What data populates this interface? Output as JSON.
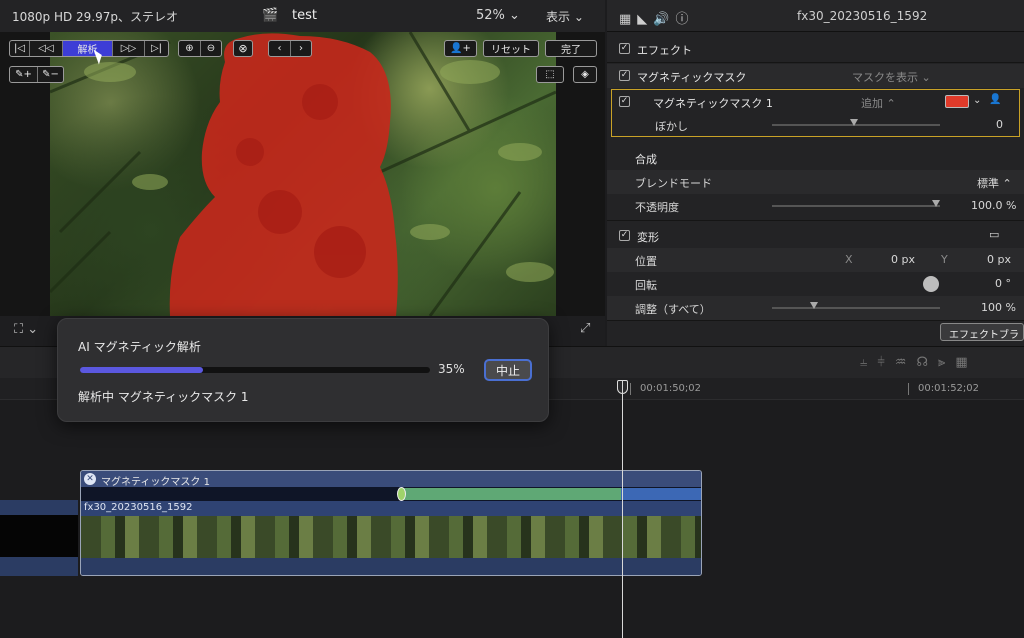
{
  "viewer": {
    "format": "1080p HD 29.97p、ステレオ",
    "project_title": "test",
    "zoom": "52% ⌄",
    "view_menu": "表示 ⌄",
    "buttons": {
      "analyze": "解析",
      "reset": "リセット",
      "done": "完了"
    }
  },
  "inspector": {
    "clip_name": "fx30_20230516_1592",
    "effects_label": "エフェクト",
    "magnetic_mask_label": "マグネティックマスク",
    "show_mask": "マスクを表示 ⌄",
    "mask1_label": "マグネティックマスク 1",
    "add_mode": "追加 ⌃",
    "feather_label": "ぼかし",
    "feather_value": "0",
    "composite_label": "合成",
    "blend_mode_label": "ブレンドモード",
    "blend_mode_value": "標準 ⌃",
    "opacity_label": "不透明度",
    "opacity_value": "100.0 %",
    "transform_label": "変形",
    "position_label": "位置",
    "pos_x_label": "X",
    "pos_x_value": "0 px",
    "pos_y_label": "Y",
    "pos_y_value": "0 px",
    "rotation_label": "回転",
    "rotation_value": "0 °",
    "scale_label": "調整（すべて）",
    "scale_value": "100 %",
    "mask_color": "#e03a2a",
    "highlight_color": "#c9a227"
  },
  "timeline": {
    "browser_button": "エフェクトブラ",
    "timecode_1": "00:01:50;02",
    "timecode_2": "00:01:52;02",
    "effect_clip_label": "マグネティックマスク 1",
    "clip_label": "fx30_20230516_1592"
  },
  "hud": {
    "title": "AI マグネティック解析",
    "progress": 35,
    "progress_label": "35%",
    "stop_button": "中止",
    "status": "解析中 マグネティックマスク 1",
    "bar_color": "#5b58e0"
  }
}
